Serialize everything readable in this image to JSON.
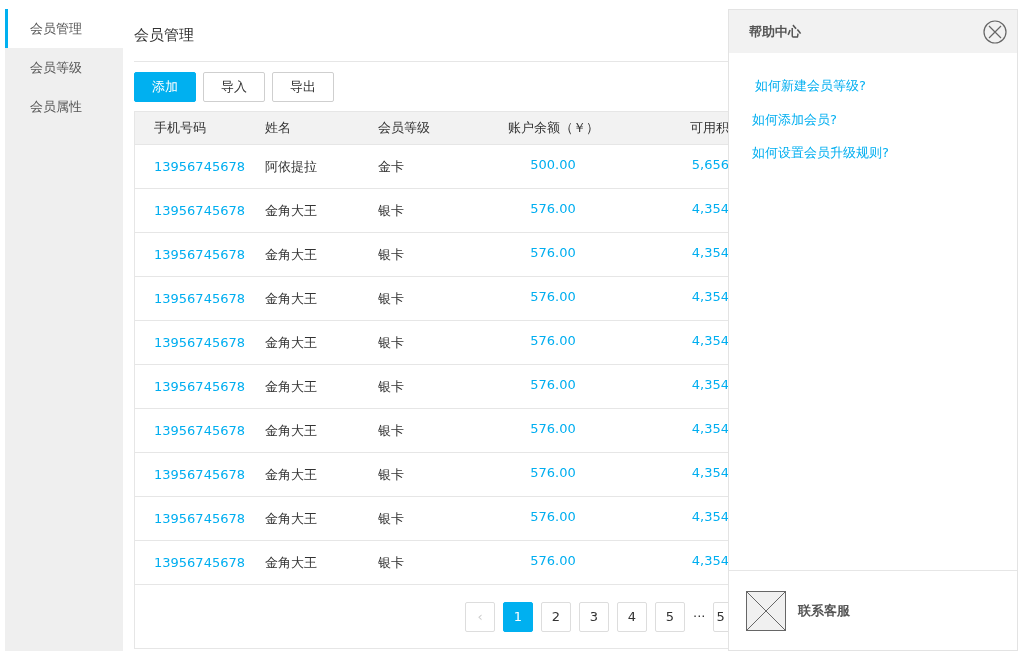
{
  "sidebar": {
    "items": [
      {
        "label": "会员管理",
        "selected": true
      },
      {
        "label": "会员等级",
        "selected": false
      },
      {
        "label": "会员属性",
        "selected": false
      }
    ]
  },
  "page_title": "会员管理",
  "toolbar": [
    {
      "label": "添加",
      "kind": "primary"
    },
    {
      "label": "导入",
      "kind": "default"
    },
    {
      "label": "导出",
      "kind": "default"
    }
  ],
  "table": {
    "columns": [
      "手机号码",
      "姓名",
      "会员等级",
      "账户余额（￥）",
      "可用积"
    ],
    "rows": [
      [
        "13956745678",
        "阿依提拉",
        "金卡",
        "500.00",
        "5,656"
      ],
      [
        "13956745678",
        "金角大王",
        "银卡",
        "576.00",
        "4,354"
      ],
      [
        "13956745678",
        "金角大王",
        "银卡",
        "576.00",
        "4,354"
      ],
      [
        "13956745678",
        "金角大王",
        "银卡",
        "576.00",
        "4,354"
      ],
      [
        "13956745678",
        "金角大王",
        "银卡",
        "576.00",
        "4,354"
      ],
      [
        "13956745678",
        "金角大王",
        "银卡",
        "576.00",
        "4,354"
      ],
      [
        "13956745678",
        "金角大王",
        "银卡",
        "576.00",
        "4,354"
      ],
      [
        "13956745678",
        "金角大王",
        "银卡",
        "576.00",
        "4,354"
      ],
      [
        "13956745678",
        "金角大王",
        "银卡",
        "576.00",
        "4,354"
      ],
      [
        "13956745678",
        "金角大王",
        "银卡",
        "576.00",
        "4,354"
      ]
    ]
  },
  "pagination": {
    "prev": {
      "label": "‹",
      "disabled": true
    },
    "pages": [
      {
        "label": "1",
        "selected": true
      },
      {
        "label": "2",
        "selected": false
      },
      {
        "label": "3",
        "selected": false
      },
      {
        "label": "4",
        "selected": false
      },
      {
        "label": "5",
        "selected": false
      }
    ],
    "ellipsis": "···",
    "last": "5"
  },
  "help_panel": {
    "title": "帮助中心",
    "links": [
      "如何新建会员等级?",
      "如何添加会员?",
      "如何设置会员升级规则?"
    ],
    "contact": "联系客服"
  }
}
